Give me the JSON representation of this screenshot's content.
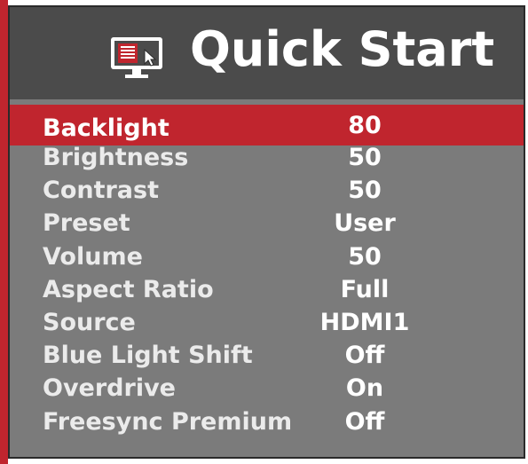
{
  "header": {
    "title": "Quick Start",
    "icon": "quick-start-menu-icon"
  },
  "colors": {
    "accent": "#c0252e",
    "header_bg": "#4b4b4b",
    "panel_bg": "#7b7b7b",
    "text": "#ebebeb"
  },
  "menu": {
    "selected_index": 0,
    "items": [
      {
        "label": "Backlight",
        "value": "80"
      },
      {
        "label": "Brightness",
        "value": "50"
      },
      {
        "label": "Contrast",
        "value": "50"
      },
      {
        "label": "Preset",
        "value": "User"
      },
      {
        "label": "Volume",
        "value": "50"
      },
      {
        "label": "Aspect Ratio",
        "value": "Full"
      },
      {
        "label": "Source",
        "value": "HDMI1"
      },
      {
        "label": "Blue Light Shift",
        "value": "Off"
      },
      {
        "label": "Overdrive",
        "value": "On"
      },
      {
        "label": "Freesync Premium",
        "value": "Off"
      }
    ]
  }
}
